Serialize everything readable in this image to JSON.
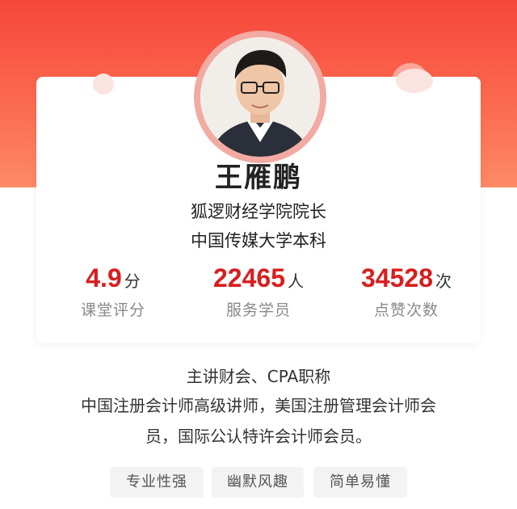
{
  "profile": {
    "name": "王雁鹏",
    "title_line1": "狐逻财经学院院长",
    "title_line2": "中国传媒大学本科"
  },
  "stats": [
    {
      "value": "4.9",
      "unit": "分",
      "label": "课堂评分"
    },
    {
      "value": "22465",
      "unit": "人",
      "label": "服务学员"
    },
    {
      "value": "34528",
      "unit": "次",
      "label": "点赞次数"
    }
  ],
  "description": {
    "line1": "主讲财会、CPA职称",
    "line2": "中国注册会计师高级讲师，美国注册管理会计师会",
    "line3": "员，国际公认特许会计师会员。"
  },
  "tags": [
    "专业性强",
    "幽默风趣",
    "简单易懂"
  ],
  "colors": {
    "header_red": "#f6463c",
    "stat_red": "#d81e1e",
    "avatar_ring": "#f2aaa3"
  }
}
